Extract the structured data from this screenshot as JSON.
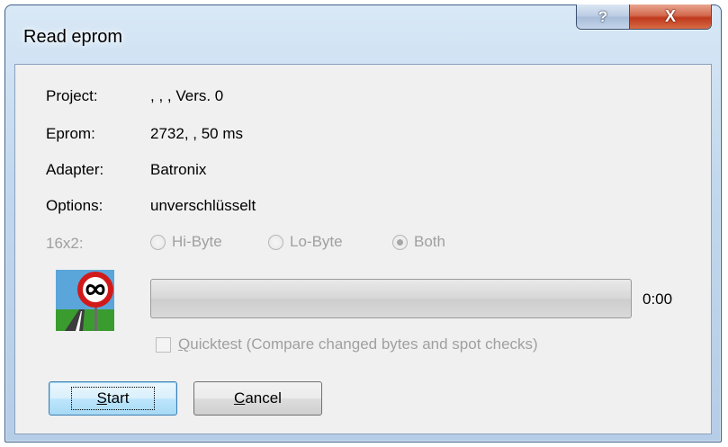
{
  "window": {
    "title": "Read eprom",
    "help_glyph": "?",
    "close_glyph": "X"
  },
  "info": {
    "project_label": "Project:",
    "project_value": ", , , Vers. 0",
    "eprom_label": "Eprom:",
    "eprom_value": "2732, , 50 ms",
    "adapter_label": "Adapter:",
    "adapter_value": "Batronix",
    "options_label": "Options:",
    "options_value": "unverschlüsselt"
  },
  "mode": {
    "label": "16x2:",
    "options": [
      "Hi-Byte",
      "Lo-Byte",
      "Both"
    ],
    "selected": "Both"
  },
  "progress": {
    "value": 0,
    "time": "0:00"
  },
  "quicktest": {
    "underlined_char": "Q",
    "label_rest": "uicktest (Compare changed bytes and spot checks)",
    "checked": false
  },
  "buttons": {
    "start_underlined": "S",
    "start_rest": "tart",
    "cancel_underlined": "C",
    "cancel_rest": "ancel"
  },
  "icons": {
    "logo": "infinity-road-sign-icon"
  }
}
